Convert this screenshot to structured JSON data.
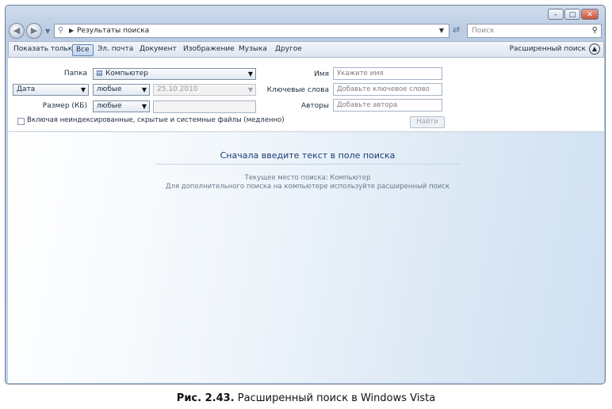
{
  "navigation": {
    "address_text": "Результаты поиска",
    "search_placeholder": "Поиск"
  },
  "filter_bar": {
    "show_only_label": "Показать только:",
    "chips": [
      "Все",
      "Эл. почта",
      "Документ",
      "Изображение",
      "Музыка",
      "Другое"
    ],
    "active_chip": "Все",
    "advanced_search_label": "Расширенный поиск"
  },
  "advanced_pane": {
    "folder_label": "Папка",
    "folder_value": "Компьютер",
    "date_type_value": "Дата",
    "date_condition_value": "любые",
    "date_value": "25.10.2010",
    "size_label": "Размер (КБ)",
    "size_condition_value": "любые",
    "size_value": "",
    "name_label": "Имя",
    "name_placeholder": "Укажите имя",
    "keywords_label": "Ключевые слова",
    "keywords_placeholder": "Добавьте ключевое слово",
    "authors_label": "Авторы",
    "authors_placeholder": "Добавьте автора",
    "include_checkbox_label": "Включая неиндексированные, скрытые и системные файлы (медленно)",
    "find_button_label": "Найти"
  },
  "content": {
    "heading": "Сначала введите текст в поле поиска",
    "current_location": "Текущее место поиска: Компьютер",
    "hint": "Для дополнительного поиска на компьютере используйте расширенный поиск"
  },
  "caption": {
    "label": "Рис. 2.43.",
    "text": "Расширенный поиск в Windows Vista"
  }
}
